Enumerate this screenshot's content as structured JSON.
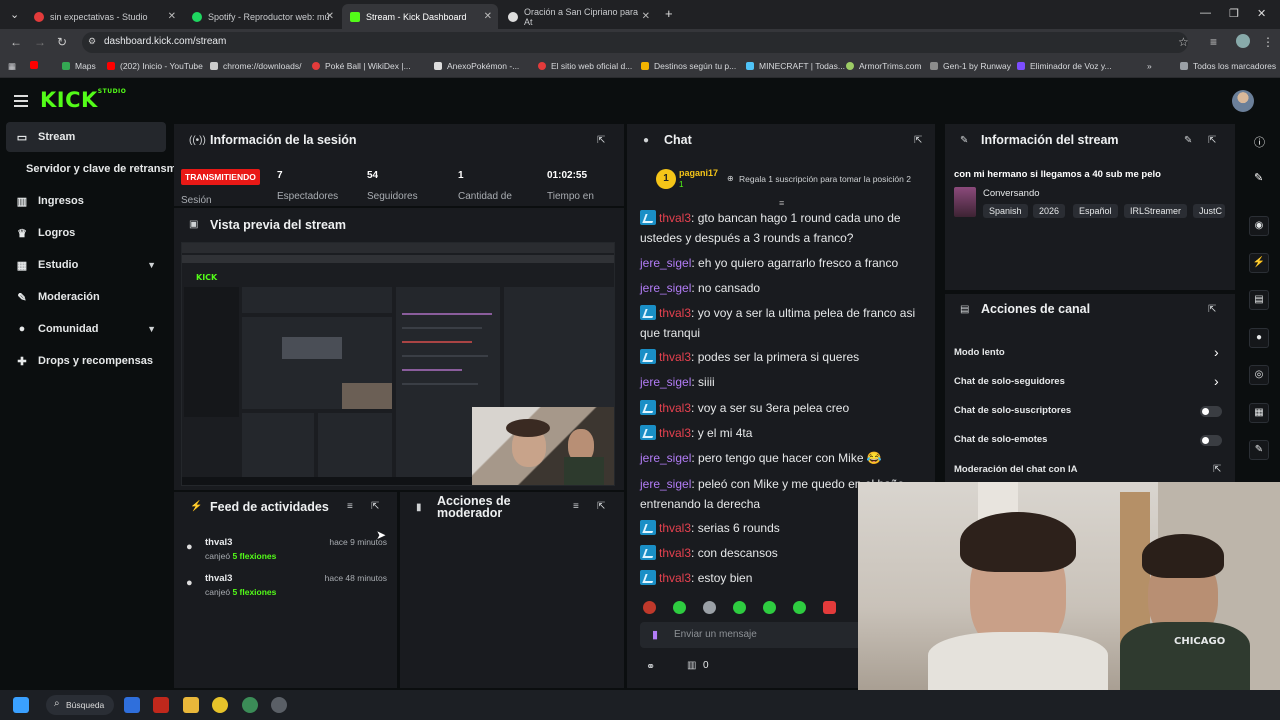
{
  "browser": {
    "tabs": [
      {
        "title": "sin expectativas - Studio",
        "color": "#e33b3b"
      },
      {
        "title": "Spotify - Reproductor web: mú",
        "color": "#1ed760"
      },
      {
        "title": "Stream - Kick Dashboard",
        "color": "#53fc18"
      },
      {
        "title": "Oración a San Cipriano para At",
        "color": "#dddddd"
      }
    ],
    "url": "dashboard.kick.com/stream",
    "bookmarks": [
      {
        "label": "Maps",
        "color": "#34a853"
      },
      {
        "label": "(202) Inicio - YouTube",
        "color": "#ff0000"
      },
      {
        "label": "chrome://downloads/",
        "color": "#cccccc"
      },
      {
        "label": "Poké Ball | WikiDex |...",
        "color": "#e33b3b"
      },
      {
        "label": "AnexoPokémon -...",
        "color": "#dddddd"
      },
      {
        "label": "El sitio web oficial d...",
        "color": "#e33b3b"
      },
      {
        "label": "Destinos según tu p...",
        "color": "#f4b400"
      },
      {
        "label": "MINECRAFT | Todas...",
        "color": "#4fc3f7"
      },
      {
        "label": "ArmorTrims.com",
        "color": "#9ccc65"
      },
      {
        "label": "Gen-1 by Runway",
        "color": "#8c8c8c"
      },
      {
        "label": "Eliminador de Voz y...",
        "color": "#7c4dff"
      }
    ],
    "all_bookmarks": "Todos los marcadores"
  },
  "brand": {
    "logo": "KICK",
    "sup": "STUDIO",
    "accent": "#53fc18"
  },
  "sidebar": {
    "items": [
      {
        "label": "Stream",
        "icon": "video-icon"
      },
      {
        "label": "Servidor y clave de retransmisión",
        "icon": ""
      },
      {
        "label": "Ingresos",
        "icon": "chart-icon"
      },
      {
        "label": "Logros",
        "icon": "trophy-icon"
      },
      {
        "label": "Estudio",
        "icon": "grid-icon"
      },
      {
        "label": "Moderación",
        "icon": "wrench-icon"
      },
      {
        "label": "Comunidad",
        "icon": "people-icon"
      },
      {
        "label": "Drops y recompensas",
        "icon": "gift-icon"
      }
    ]
  },
  "session": {
    "title": "Información de la sesión",
    "status": "TRANSMITIENDO",
    "status_label": "Sesión",
    "stats": [
      {
        "value": "7",
        "label": "Espectadores"
      },
      {
        "value": "54",
        "label": "Seguidores"
      },
      {
        "value": "1",
        "label": "Cantidad de"
      },
      {
        "value": "01:02:55",
        "label": "Tiempo en"
      }
    ]
  },
  "preview": {
    "title": "Vista previa del stream"
  },
  "activity": {
    "title": "Feed de actividades",
    "items": [
      {
        "user": "thval3",
        "action": "canjeó",
        "reward": "5 flexiones",
        "time": "hace 9 minutos"
      },
      {
        "user": "thval3",
        "action": "canjeó",
        "reward": "5 flexiones",
        "time": "hace 48 minutos"
      }
    ]
  },
  "mod_actions": {
    "title": "Acciones de moderador"
  },
  "chat": {
    "title": "Chat",
    "pinned": {
      "user": "pagani17",
      "rank": "1",
      "count": "1",
      "text": "Regala 1 suscripción para tomar la posición 2"
    },
    "messages": [
      {
        "user": "thval3",
        "text": "gto bancan hago 1 round cada uno de ustedes y después a 3 rounds a franco?"
      },
      {
        "user": "jere_sigel",
        "text": "eh yo quiero agarrarlo fresco a franco"
      },
      {
        "user": "jere_sigel",
        "text": "no cansado"
      },
      {
        "user": "thval3",
        "text": "yo voy a ser la ultima pelea de franco asi que tranqui"
      },
      {
        "user": "thval3",
        "text": "podes ser la primera si queres"
      },
      {
        "user": "jere_sigel",
        "text": "siiii"
      },
      {
        "user": "thval3",
        "text": "voy a ser su 3era pelea creo"
      },
      {
        "user": "thval3",
        "text": "y el mi 4ta"
      },
      {
        "user": "jere_sigel",
        "text": "pero tengo que hacer con Mike 😂"
      },
      {
        "user": "jere_sigel",
        "text": "peleó con Mike y me quedo en el baño entrenando la derecha"
      },
      {
        "user": "thval3",
        "text": "serias 6 rounds"
      },
      {
        "user": "thval3",
        "text": "con descansos"
      },
      {
        "user": "thval3",
        "text": "estoy bien"
      }
    ],
    "input_placeholder": "Enviar un mensaje",
    "footer_count": "0"
  },
  "stream_info": {
    "title": "Información del stream",
    "stream_title": "con mi hermano si llegamos a 40 sub me pelo",
    "category": "Conversando",
    "tags": [
      "Spanish",
      "2026",
      "Español",
      "IRLStreamer",
      "JustC"
    ]
  },
  "channel_actions": {
    "title": "Acciones de canal",
    "items": [
      {
        "label": "Modo lento",
        "control": "arrow"
      },
      {
        "label": "Chat de solo-seguidores",
        "control": "arrow"
      },
      {
        "label": "Chat de solo-suscriptores",
        "control": "toggle"
      },
      {
        "label": "Chat de solo-emotes",
        "control": "toggle"
      },
      {
        "label": "Moderación del chat con IA",
        "control": "open"
      }
    ]
  },
  "taskbar": {
    "search": "Búsqueda"
  }
}
